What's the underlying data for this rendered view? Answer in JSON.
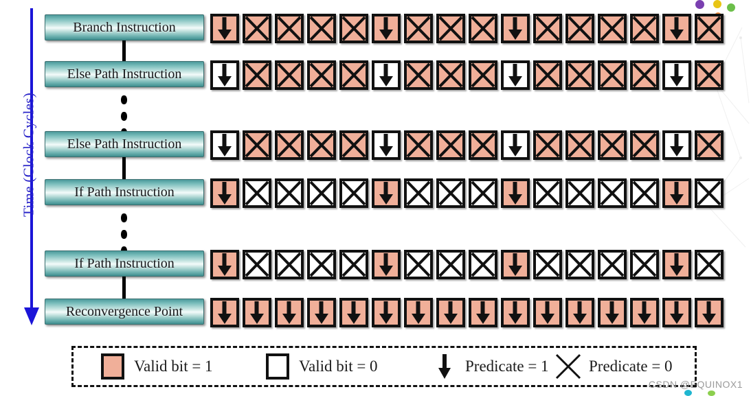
{
  "axis": {
    "label": "Time (Clock Cycles)",
    "color": "#2a24c9",
    "direction": "down"
  },
  "colors": {
    "valid_bit_1": "#f0af99",
    "valid_bit_0": "#ffffff",
    "box_border": "#111111",
    "label_box_teal": "#4c9a9b",
    "axis_blue": "#1b15d8"
  },
  "grid": {
    "lanes": 16,
    "predicate_true_lanes": [
      1,
      6,
      10,
      15
    ],
    "rows": [
      {
        "label": "Branch Instruction",
        "cells": [
          {
            "valid": true,
            "predicate": 1
          },
          {
            "valid": true,
            "predicate": 0
          },
          {
            "valid": true,
            "predicate": 0
          },
          {
            "valid": true,
            "predicate": 0
          },
          {
            "valid": true,
            "predicate": 0
          },
          {
            "valid": true,
            "predicate": 1
          },
          {
            "valid": true,
            "predicate": 0
          },
          {
            "valid": true,
            "predicate": 0
          },
          {
            "valid": true,
            "predicate": 0
          },
          {
            "valid": true,
            "predicate": 1
          },
          {
            "valid": true,
            "predicate": 0
          },
          {
            "valid": true,
            "predicate": 0
          },
          {
            "valid": true,
            "predicate": 0
          },
          {
            "valid": true,
            "predicate": 0
          },
          {
            "valid": true,
            "predicate": 1
          },
          {
            "valid": true,
            "predicate": 0
          }
        ]
      },
      {
        "label": "Else Path Instruction",
        "cells": [
          {
            "valid": false,
            "predicate": 1
          },
          {
            "valid": true,
            "predicate": 0
          },
          {
            "valid": true,
            "predicate": 0
          },
          {
            "valid": true,
            "predicate": 0
          },
          {
            "valid": true,
            "predicate": 0
          },
          {
            "valid": false,
            "predicate": 1
          },
          {
            "valid": true,
            "predicate": 0
          },
          {
            "valid": true,
            "predicate": 0
          },
          {
            "valid": true,
            "predicate": 0
          },
          {
            "valid": false,
            "predicate": 1
          },
          {
            "valid": true,
            "predicate": 0
          },
          {
            "valid": true,
            "predicate": 0
          },
          {
            "valid": true,
            "predicate": 0
          },
          {
            "valid": true,
            "predicate": 0
          },
          {
            "valid": false,
            "predicate": 1
          },
          {
            "valid": true,
            "predicate": 0
          }
        ]
      },
      {
        "label": "Else Path Instruction",
        "cells": [
          {
            "valid": false,
            "predicate": 1
          },
          {
            "valid": true,
            "predicate": 0
          },
          {
            "valid": true,
            "predicate": 0
          },
          {
            "valid": true,
            "predicate": 0
          },
          {
            "valid": true,
            "predicate": 0
          },
          {
            "valid": false,
            "predicate": 1
          },
          {
            "valid": true,
            "predicate": 0
          },
          {
            "valid": true,
            "predicate": 0
          },
          {
            "valid": true,
            "predicate": 0
          },
          {
            "valid": false,
            "predicate": 1
          },
          {
            "valid": true,
            "predicate": 0
          },
          {
            "valid": true,
            "predicate": 0
          },
          {
            "valid": true,
            "predicate": 0
          },
          {
            "valid": true,
            "predicate": 0
          },
          {
            "valid": false,
            "predicate": 1
          },
          {
            "valid": true,
            "predicate": 0
          }
        ]
      },
      {
        "label": "If Path Instruction",
        "cells": [
          {
            "valid": true,
            "predicate": 1
          },
          {
            "valid": false,
            "predicate": 0
          },
          {
            "valid": false,
            "predicate": 0
          },
          {
            "valid": false,
            "predicate": 0
          },
          {
            "valid": false,
            "predicate": 0
          },
          {
            "valid": true,
            "predicate": 1
          },
          {
            "valid": false,
            "predicate": 0
          },
          {
            "valid": false,
            "predicate": 0
          },
          {
            "valid": false,
            "predicate": 0
          },
          {
            "valid": true,
            "predicate": 1
          },
          {
            "valid": false,
            "predicate": 0
          },
          {
            "valid": false,
            "predicate": 0
          },
          {
            "valid": false,
            "predicate": 0
          },
          {
            "valid": false,
            "predicate": 0
          },
          {
            "valid": true,
            "predicate": 1
          },
          {
            "valid": false,
            "predicate": 0
          }
        ]
      },
      {
        "label": "If Path Instruction",
        "cells": [
          {
            "valid": true,
            "predicate": 1
          },
          {
            "valid": false,
            "predicate": 0
          },
          {
            "valid": false,
            "predicate": 0
          },
          {
            "valid": false,
            "predicate": 0
          },
          {
            "valid": false,
            "predicate": 0
          },
          {
            "valid": true,
            "predicate": 1
          },
          {
            "valid": false,
            "predicate": 0
          },
          {
            "valid": false,
            "predicate": 0
          },
          {
            "valid": false,
            "predicate": 0
          },
          {
            "valid": true,
            "predicate": 1
          },
          {
            "valid": false,
            "predicate": 0
          },
          {
            "valid": false,
            "predicate": 0
          },
          {
            "valid": false,
            "predicate": 0
          },
          {
            "valid": false,
            "predicate": 0
          },
          {
            "valid": true,
            "predicate": 1
          },
          {
            "valid": false,
            "predicate": 0
          }
        ]
      },
      {
        "label": "Reconvergence Point",
        "cells": [
          {
            "valid": true,
            "predicate": 1
          },
          {
            "valid": true,
            "predicate": 1
          },
          {
            "valid": true,
            "predicate": 1
          },
          {
            "valid": true,
            "predicate": 1
          },
          {
            "valid": true,
            "predicate": 1
          },
          {
            "valid": true,
            "predicate": 1
          },
          {
            "valid": true,
            "predicate": 1
          },
          {
            "valid": true,
            "predicate": 1
          },
          {
            "valid": true,
            "predicate": 1
          },
          {
            "valid": true,
            "predicate": 1
          },
          {
            "valid": true,
            "predicate": 1
          },
          {
            "valid": true,
            "predicate": 1
          },
          {
            "valid": true,
            "predicate": 1
          },
          {
            "valid": true,
            "predicate": 1
          },
          {
            "valid": true,
            "predicate": 1
          },
          {
            "valid": true,
            "predicate": 1
          }
        ]
      }
    ],
    "ellipsis_after_rows": [
      1,
      3
    ]
  },
  "legend": {
    "items": [
      {
        "glyph": "pink-square-icon",
        "label": "Valid bit = 1"
      },
      {
        "glyph": "white-square-icon",
        "label": "Valid bit = 0"
      },
      {
        "glyph": "down-arrow-icon",
        "label": "Predicate = 1"
      },
      {
        "glyph": "cross-icon",
        "label": "Predicate = 0"
      }
    ]
  },
  "watermark": {
    "text": "CSDN @EQUINOX1"
  }
}
